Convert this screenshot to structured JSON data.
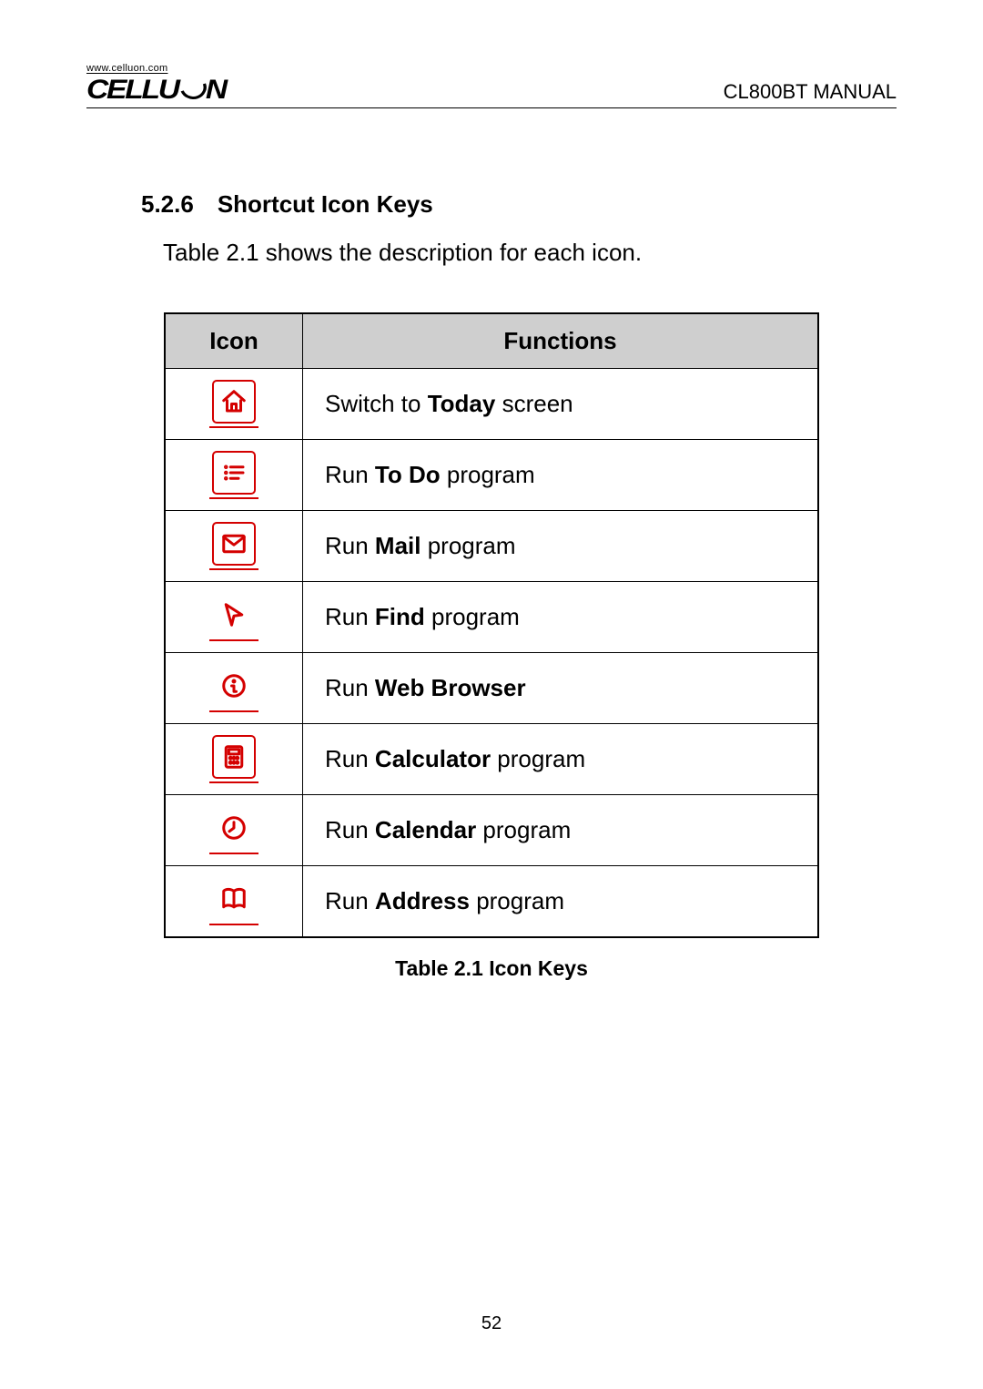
{
  "header": {
    "brand_url": "www.celluon.com",
    "brand_name": "CELLUON",
    "doc_title": "CL800BT MANUAL"
  },
  "section": {
    "number": "5.2.6",
    "title": "Shortcut Icon Keys",
    "intro": "Table 2.1 shows the description for each icon."
  },
  "table": {
    "head_icon": "Icon",
    "head_functions": "Functions",
    "caption": "Table 2.1 Icon Keys",
    "rows": [
      {
        "prefix": "Switch to ",
        "bold": "Today",
        "suffix": " screen"
      },
      {
        "prefix": "Run ",
        "bold": "To Do",
        "suffix": " program"
      },
      {
        "prefix": "Run ",
        "bold": "Mail",
        "suffix": " program"
      },
      {
        "prefix": "Run ",
        "bold": "Find",
        "suffix": " program"
      },
      {
        "prefix": "Run ",
        "bold": "Web Browser",
        "suffix": ""
      },
      {
        "prefix": "Run ",
        "bold": "Calculator",
        "suffix": " program"
      },
      {
        "prefix": "Run ",
        "bold": "Calendar",
        "suffix": " program"
      },
      {
        "prefix": "Run ",
        "bold": "Address",
        "suffix": " program"
      }
    ]
  },
  "page_number": "52"
}
